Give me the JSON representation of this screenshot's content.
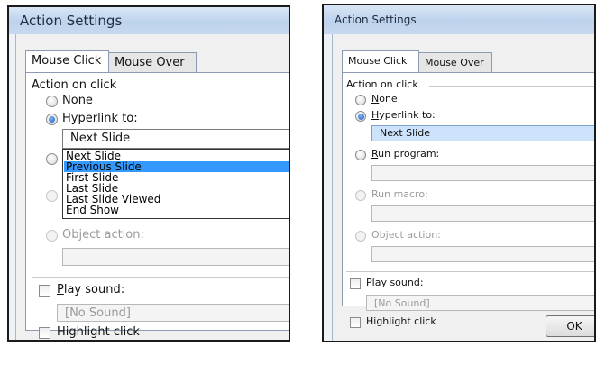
{
  "left": {
    "title": "Action Settings",
    "tabs": [
      "Mouse Click",
      "Mouse Over"
    ],
    "action_group_label": "Action on click",
    "options": {
      "none": "None",
      "hyperlink": "Hyperlink to:",
      "object_action": "Object action:"
    },
    "hyperlink_value": "Next Slide",
    "dropdown_items": [
      "Next Slide",
      "Previous Slide",
      "First Slide",
      "Last Slide",
      "Last Slide Viewed",
      "End Show"
    ],
    "dropdown_highlighted": "Previous Slide",
    "play_sound": "Play sound:",
    "sound_value": "[No Sound]",
    "highlight_click": "Highlight click"
  },
  "right": {
    "title": "Action Settings",
    "tabs": [
      "Mouse Click",
      "Mouse Over"
    ],
    "action_group_label": "Action on click",
    "options": {
      "none": "None",
      "hyperlink": "Hyperlink to:",
      "run_program": "Run program:",
      "run_macro": "Run macro:",
      "object_action": "Object action:"
    },
    "hyperlink_value": "Next Slide",
    "play_sound": "Play sound:",
    "sound_value": "[No Sound]",
    "highlight_click": "Highlight click",
    "ok_label": "OK"
  },
  "colors": {
    "selection": "#3399ff",
    "title_gradient": "#bdd2ec",
    "dialog_bg": "#f0f0f0"
  },
  "icons": [
    "radio-button",
    "checkbox"
  ]
}
